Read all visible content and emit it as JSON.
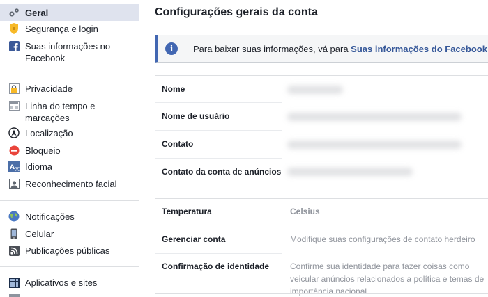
{
  "sidebar": {
    "items": [
      {
        "label": "Geral",
        "icon": "gear-icon"
      },
      {
        "label": "Segurança e login",
        "icon": "shield-icon"
      },
      {
        "label": "Suas informações no Facebook",
        "icon": "facebook-icon"
      },
      {
        "label": "Privacidade",
        "icon": "lock-icon"
      },
      {
        "label": "Linha do tempo e marcações",
        "icon": "timeline-icon"
      },
      {
        "label": "Localização",
        "icon": "location-icon"
      },
      {
        "label": "Bloqueio",
        "icon": "block-icon"
      },
      {
        "label": "Idioma",
        "icon": "language-icon"
      },
      {
        "label": "Reconhecimento facial",
        "icon": "face-recognition-icon"
      },
      {
        "label": "Notificações",
        "icon": "globe-icon"
      },
      {
        "label": "Celular",
        "icon": "mobile-icon"
      },
      {
        "label": "Publicações públicas",
        "icon": "rss-icon"
      },
      {
        "label": "Aplicativos e sites",
        "icon": "apps-icon"
      }
    ]
  },
  "main": {
    "title": "Configurações gerais da conta",
    "info": {
      "text": "Para baixar suas informações, vá para ",
      "link": "Suas informações do Facebook"
    },
    "rows": [
      {
        "label": "Nome",
        "value": ""
      },
      {
        "label": "Nome de usuário",
        "value": ""
      },
      {
        "label": "Contato",
        "value": ""
      },
      {
        "label": "Contato da conta de anúncios",
        "value": ""
      },
      {
        "label": "Temperatura",
        "value": "Celsius"
      },
      {
        "label": "Gerenciar conta",
        "value": "Modifique suas configurações de contato herdeiro"
      },
      {
        "label": "Confirmação de identidade",
        "value": "Confirme sua identidade para fazer coisas como veicular anúncios relacionados a política e temas de importância nacional."
      }
    ]
  },
  "colors": {
    "accent": "#4267b2",
    "link": "#365899",
    "active_bg": "#dfe3ee"
  }
}
